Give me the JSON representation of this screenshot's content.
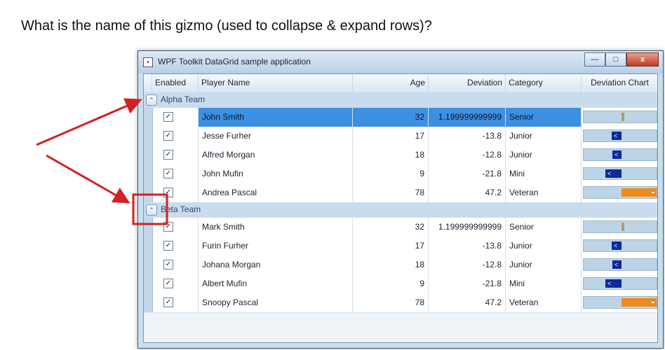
{
  "question": "What is the name of this gizmo (used to collapse & expand rows)?",
  "window": {
    "title": "WPF Toolkit DataGrid sample application",
    "minimize_label": "—",
    "maximize_label": "□",
    "close_label": "x"
  },
  "columns": {
    "enabled": "Enabled",
    "name": "Player Name",
    "age": "Age",
    "deviation": "Deviation",
    "category": "Category",
    "chart": "Deviation Chart"
  },
  "groups": [
    {
      "label": "Alpha Team",
      "rows": [
        {
          "enabled": true,
          "name": "John Smith",
          "age": "32",
          "deviation": "1.199999999999",
          "category": "Senior",
          "dev_value": 1.2,
          "selected": true
        },
        {
          "enabled": true,
          "name": "Jesse Furher",
          "age": "17",
          "deviation": "-13.8",
          "category": "Junior",
          "dev_value": -13.8,
          "selected": false
        },
        {
          "enabled": true,
          "name": "Alfred Morgan",
          "age": "18",
          "deviation": "-12.8",
          "category": "Junior",
          "dev_value": -12.8,
          "selected": false
        },
        {
          "enabled": true,
          "name": "John Mufin",
          "age": "9",
          "deviation": "-21.8",
          "category": "Mini",
          "dev_value": -21.8,
          "selected": false
        },
        {
          "enabled": true,
          "name": "Andrea Pascal",
          "age": "78",
          "deviation": "47.2",
          "category": "Veteran",
          "dev_value": 47.2,
          "selected": false
        }
      ]
    },
    {
      "label": "Beta Team",
      "rows": [
        {
          "enabled": true,
          "name": "Mark Smith",
          "age": "32",
          "deviation": "1.199999999999",
          "category": "Senior",
          "dev_value": 1.2,
          "selected": false
        },
        {
          "enabled": true,
          "name": "Furin Furher",
          "age": "17",
          "deviation": "-13.8",
          "category": "Junior",
          "dev_value": -13.8,
          "selected": false
        },
        {
          "enabled": true,
          "name": "Johana Morgan",
          "age": "18",
          "deviation": "-12.8",
          "category": "Junior",
          "dev_value": -12.8,
          "selected": false
        },
        {
          "enabled": true,
          "name": "Albert Mufin",
          "age": "9",
          "deviation": "-21.8",
          "category": "Mini",
          "dev_value": -21.8,
          "selected": false
        },
        {
          "enabled": true,
          "name": "Snoopy Pascal",
          "age": "78",
          "deviation": "47.2",
          "category": "Veteran",
          "dev_value": 47.2,
          "selected": false
        }
      ]
    }
  ],
  "icons": {
    "expander": "chevron-up-icon",
    "checkbox": "checkmark-icon",
    "neg_bar_arrow": "left-arrow-icon"
  },
  "colors": {
    "annotation": "#d42020",
    "selection": "#3d8fe0",
    "neg_bar": "#0c2a9a",
    "pos_bar": "#f08a1c"
  }
}
